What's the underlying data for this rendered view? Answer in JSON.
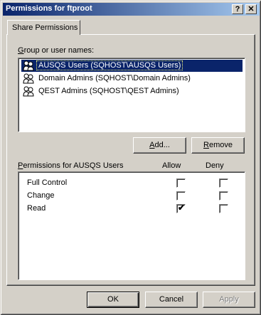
{
  "window": {
    "title": "Permissions for ftproot",
    "help_button": "?",
    "close_button": "✕"
  },
  "tabs": [
    {
      "label": "Share Permissions",
      "active": true
    }
  ],
  "group_section": {
    "label_prefix": "G",
    "label_rest": "roup or user names:",
    "items": [
      {
        "label": "AUSQS Users (SQHOST\\AUSQS Users)",
        "selected": true,
        "icon": "users-group-icon"
      },
      {
        "label": "Domain Admins (SQHOST\\Domain Admins)",
        "selected": false,
        "icon": "users-group-icon"
      },
      {
        "label": "QEST Admins (SQHOST\\QEST Admins)",
        "selected": false,
        "icon": "users-group-icon"
      }
    ],
    "add_prefix": "A",
    "add_label": "dd...",
    "remove_prefix": "R",
    "remove_label": "emove"
  },
  "permissions_section": {
    "label_prefix": "P",
    "label_rest": "ermissions for AUSQS Users",
    "allow_header": "Allow",
    "deny_header": "Deny",
    "rows": [
      {
        "name": "Full Control",
        "allow": false,
        "deny": false
      },
      {
        "name": "Change",
        "allow": false,
        "deny": false
      },
      {
        "name": "Read",
        "allow": true,
        "deny": false
      }
    ]
  },
  "footer": {
    "ok_label": "OK",
    "cancel_label": "Cancel",
    "apply_label": "Apply",
    "apply_enabled": false
  },
  "check_glyph": "✔"
}
